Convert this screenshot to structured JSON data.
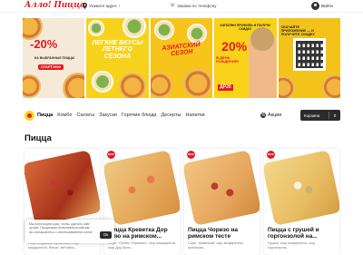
{
  "header": {
    "logo": "Алло! Пицца",
    "address_prompt": "Укажите адрес",
    "order_phone": "Закажи по телефону",
    "login": "Войти"
  },
  "banners": [
    {
      "big": "-20%",
      "sub": "НА ВЫБРАННЫЕ ПИЦЦЫ",
      "promo": "СТАРТ1000"
    },
    {
      "text": "ЛЕГКИЕ ВКУСЫ ЛЕТНЕГО СЕЗОНА"
    },
    {
      "text": "АЗИАТСКИЙ СЕЗОН"
    },
    {
      "head": "ЗАПОЛНИ ПРОФИЛЬ И ПОЛУЧИ СКИДКУ",
      "big": "20%",
      "sub": "В ДЕНЬ РОЖДЕНИЯ!",
      "code": "ДР20"
    },
    {
      "text": "СКАЧАЙТЕ ПРИЛОЖЕНИЕ — И ПОЛУЧИТЕ СКИДКУ"
    }
  ],
  "categories": [
    "Пицца",
    "Комбо",
    "Салаты",
    "Закуски",
    "Горячие блюда",
    "Десерты",
    "Напитки"
  ],
  "promo_link": "Акции",
  "cart": {
    "label": "Корзина",
    "count": "0"
  },
  "section_title": "Пицца",
  "products": [
    {
      "name": "",
      "desc": "Соус Медовая горчичная, сыр моцарелла, бекон, ветчина..."
    },
    {
      "name": "Пицца Креветка Дор Блю на римском...",
      "desc": "Соус: «Гриль Терияки», сыр моцарелла, сыр Дор Блю..."
    },
    {
      "name": "Пицца Чоризо на римском тесте",
      "desc": "Соус: томатный, сыр моцарелла, колбаски..."
    },
    {
      "name": "Пицца с грушей и горгонзолой на...",
      "desc": "Груша, сыр моцарелла, сыр горгонзола..."
    }
  ],
  "cookie": {
    "text": "Мы используем куки, чтобы сделать сайт лучше. Продолжая пользоваться сайтом, вы соглашаетесь с использованием cookie.",
    "ok": "Ок"
  },
  "colors": {
    "brand_red": "#e31b23",
    "brand_yellow": "#fdd51e",
    "dark": "#2b2b2b"
  }
}
